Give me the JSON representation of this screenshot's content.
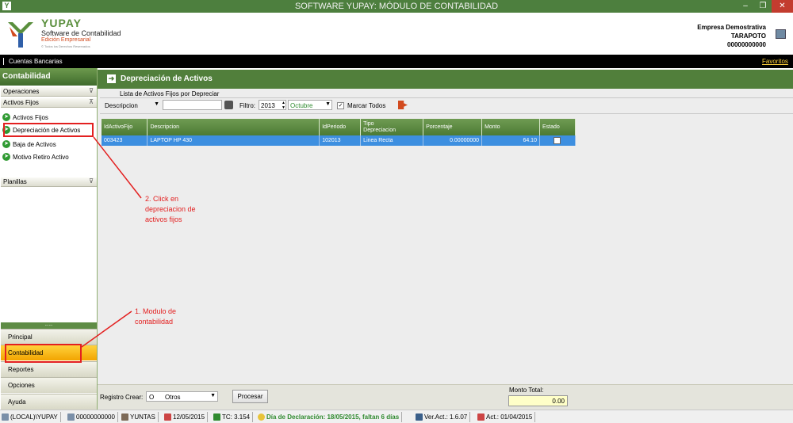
{
  "window": {
    "title": "SOFTWARE YUPAY: MÓDULO DE CONTABILIDAD",
    "app_icon": "Y"
  },
  "logo": {
    "brand": "YUPAY",
    "line1": "Software de Contabilidad",
    "line2": "Edición Empresarial",
    "line3": "© Todos los Derechos Reservados"
  },
  "company": {
    "name": "Empresa Demostrativa",
    "city": "TARAPOTO",
    "ruc": "00000000000"
  },
  "menubar": {
    "left": "Cuentas Bancarias",
    "right": "Favoritos"
  },
  "left_panel": {
    "title": "Contabilidad",
    "sections": {
      "operaciones": "Operaciones",
      "activos_fijos": "Activos Fijos",
      "planillas": "Planillas"
    },
    "items": [
      "Activos Fijos",
      "Depreciación de Activos",
      "Baja de Activos",
      "Motivo Retiro Activo"
    ],
    "splitter": "......",
    "bottom_buttons": [
      "Principal",
      "Contabilidad",
      "Reportes",
      "Opciones",
      "Ayuda"
    ]
  },
  "main": {
    "title": "Depreciación de Activos",
    "subtitle": "Lista de Activos Fijos por Depreciar",
    "toolbar": {
      "filter_field": "Descripcion",
      "search_value": "",
      "filtro_label": "Filtro:",
      "year": "2013",
      "month": "Octubre",
      "marcar_todos": "Marcar Todos"
    },
    "table": {
      "columns": [
        "IdActivoFijo",
        "Descripcion",
        "IdPeriodo",
        "Tipo\nDepreciacion",
        "Porcentaje",
        "Monto",
        "Estado"
      ],
      "rows": [
        [
          "003423",
          "LAPTOP HP 430",
          "102013",
          "Linea Recta",
          "0.00000000",
          "64.10",
          ""
        ]
      ]
    },
    "bottom": {
      "registro_label": "Registro Crear:",
      "registro_code": "O",
      "registro_value": "Otros",
      "procesar": "Procesar",
      "monto_total_label": "Monto Total:",
      "monto_total_value": "0.00"
    }
  },
  "status": {
    "server": "(LOCAL)\\YUPAY",
    "ruc": "00000000000",
    "user": "YUNTAS",
    "date": "12/05/2015",
    "tc": "TC: 3.154",
    "declaracion": "Día de Declaración: 18/05/2015, faltan 6 días",
    "version": "Ver.Act.: 1.6.07",
    "act": "Act.: 01/04/2015"
  },
  "annotations": {
    "a1": "1. Modulo de\ncontabilidad",
    "a2": "2. Click en\ndepreciacion de\nactivos fijos"
  },
  "colors": {
    "titlebar": "#4d7f3e",
    "accent_green": "#517f3b",
    "selected_row": "#3d8fe0",
    "active_button": "#f2a400",
    "annotation": "#e32020"
  }
}
